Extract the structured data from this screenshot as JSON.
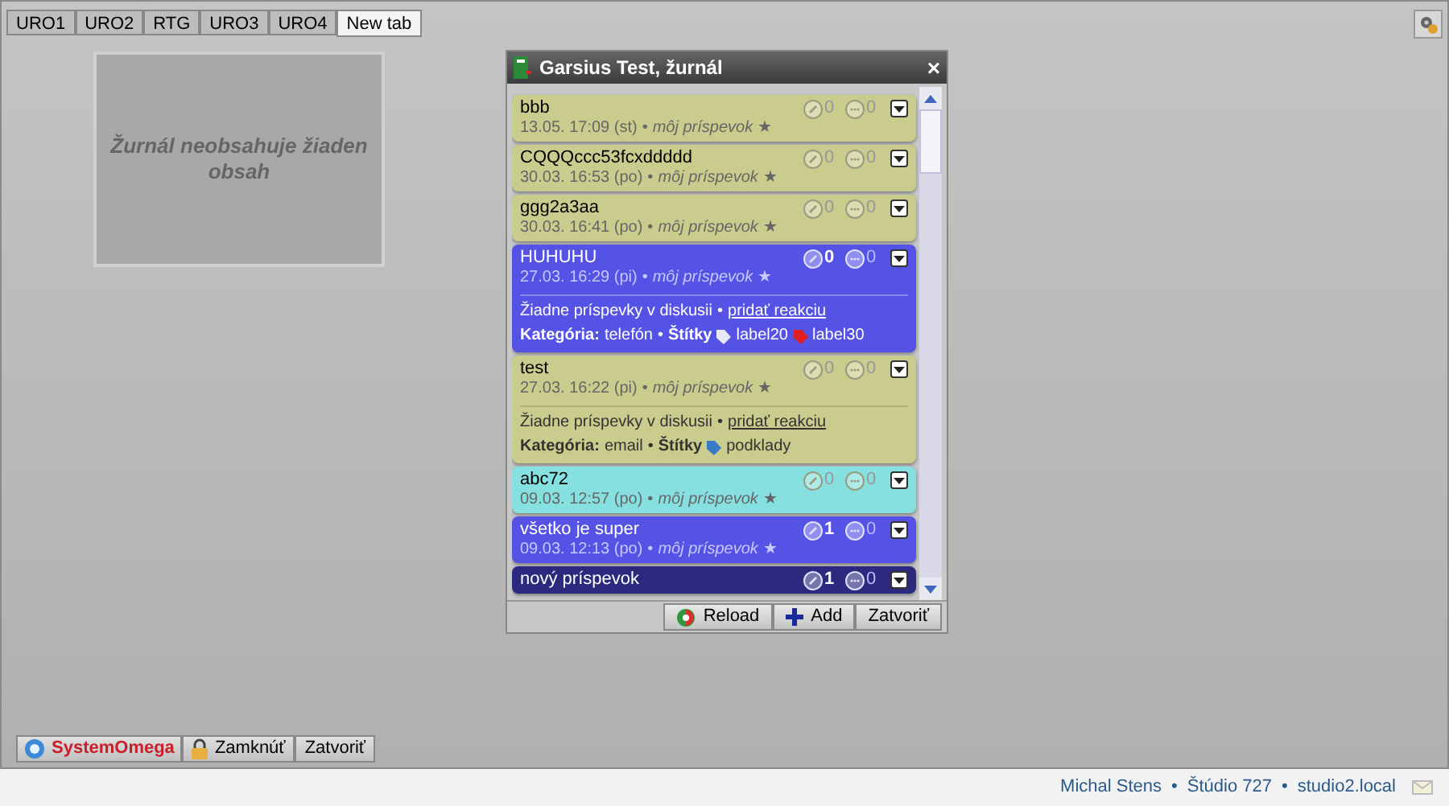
{
  "tabs": [
    {
      "label": "URO1",
      "selected": false
    },
    {
      "label": "URO2",
      "selected": false
    },
    {
      "label": "RTG",
      "selected": false
    },
    {
      "label": "URO3",
      "selected": false
    },
    {
      "label": "URO4",
      "selected": false
    },
    {
      "label": "New tab",
      "selected": true
    }
  ],
  "empty_panel": {
    "message": "Žurnál neobsahuje žiaden obsah"
  },
  "dialog": {
    "title": "Garsius Test, žurnál",
    "close": "×",
    "separator": "•",
    "posts": [
      {
        "title": "bbb",
        "meta": "13.05. 17:09 (st)",
        "author": "môj príspevok",
        "star": "★",
        "attachments": "0",
        "comments": "0",
        "color": "#c9cc8c",
        "expanded": false
      },
      {
        "title": "CQQQccc53fcxddddd",
        "meta": "30.03. 16:53 (po)",
        "author": "môj príspevok",
        "star": "★",
        "attachments": "0",
        "comments": "0",
        "color": "#c9cc8c",
        "expanded": false
      },
      {
        "title": "ggg2a3aa",
        "meta": "30.03. 16:41 (po)",
        "author": "môj príspevok",
        "star": "★",
        "attachments": "0",
        "comments": "0",
        "color": "#c9cc8c",
        "expanded": false
      },
      {
        "title": "HUHUHU",
        "meta": "27.03. 16:29 (pi)",
        "author": "môj príspevok",
        "star": "★",
        "attachments": "0",
        "comments": "0",
        "color": "#5552e6",
        "expanded": true,
        "discussion": "Žiadne príspevky v diskusii",
        "add_reaction": "pridať reakciu",
        "category_label": "Kategória:",
        "category": "telefón",
        "tags_label": "Štítky",
        "tags": [
          {
            "label": "label20",
            "color": "#e8e8f8"
          },
          {
            "label": "label30",
            "color": "#e02020"
          }
        ]
      },
      {
        "title": "test",
        "meta": "27.03. 16:22 (pi)",
        "author": "môj príspevok",
        "star": "★",
        "attachments": "0",
        "comments": "0",
        "color": "#c9cc8c",
        "expanded": true,
        "discussion": "Žiadne príspevky v diskusii",
        "add_reaction": "pridať reakciu",
        "category_label": "Kategória:",
        "category": "email",
        "tags_label": "Štítky",
        "tags": [
          {
            "label": "podklady",
            "color": "#3a78c8"
          }
        ]
      },
      {
        "title": "abc72",
        "meta": "09.03. 12:57 (po)",
        "author": "môj príspevok",
        "star": "★",
        "attachments": "0",
        "comments": "0",
        "color": "#86e0e0",
        "expanded": false
      },
      {
        "title": "všetko je super",
        "meta": "09.03. 12:13 (po)",
        "author": "môj príspevok",
        "star": "★",
        "attachments": "1",
        "comments": "0",
        "color": "#5552e6",
        "expanded": false
      },
      {
        "title": "nový príspevok",
        "attachments": "1",
        "comments": "0",
        "color": "#2c2a7e",
        "expanded": false
      }
    ],
    "buttons": [
      {
        "label": "Reload",
        "kind": "reload"
      },
      {
        "label": "Add",
        "kind": "add"
      },
      {
        "label": "Zatvoriť",
        "kind": "plain"
      }
    ]
  },
  "bottom_bar": {
    "brand": "SystemOmega",
    "buttons": [
      {
        "label": "Zamknúť",
        "kind": "lock"
      },
      {
        "label": "Zatvoriť",
        "kind": "plain"
      }
    ]
  },
  "status_bar": {
    "user": "Michal Stens",
    "studio": "Štúdio 727",
    "host": "studio2.local",
    "separator": "•"
  }
}
